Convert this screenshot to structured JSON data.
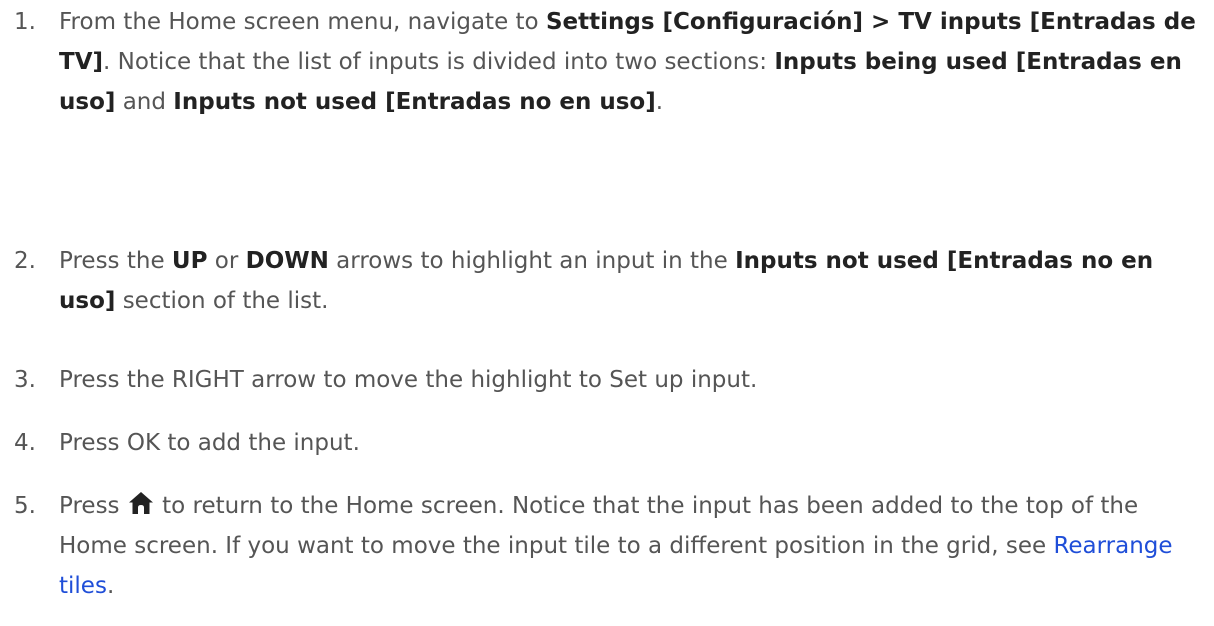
{
  "steps": [
    {
      "num": "1.",
      "p1": "From the Home screen menu, navigate to ",
      "b1": "Settings [Configuración] > TV inputs [Entradas de TV]",
      "p2": ". Notice that the list of inputs is divided into two sections: ",
      "b2": "Inputs being used [Entradas en uso]",
      "p3": " and ",
      "b3": "Inputs not used [Entradas no en uso]",
      "p4": "."
    },
    {
      "num": "2.",
      "p1": "Press the ",
      "b1": "UP",
      "p2": " or ",
      "b2": "DOWN",
      "p3": " arrows to highlight an input in the ",
      "b3": "Inputs not used [Entradas no en uso]",
      "p4": " section of the list."
    },
    {
      "num": "3.",
      "text": "Press the RIGHT arrow to move the highlight to Set up input."
    },
    {
      "num": "4.",
      "text": "Press OK to add the input."
    },
    {
      "num": "5.",
      "p1": "Press ",
      "icon": "home-icon",
      "p2": " to return to the Home screen. Notice that the input has been added to the top of the Home screen. If you want to move the input tile to a different position in the grid, see ",
      "link": "Rearrange tiles",
      "p3": "."
    }
  ],
  "colors": {
    "text": "#555555",
    "bold": "#222222",
    "link": "#1f4ed8"
  }
}
